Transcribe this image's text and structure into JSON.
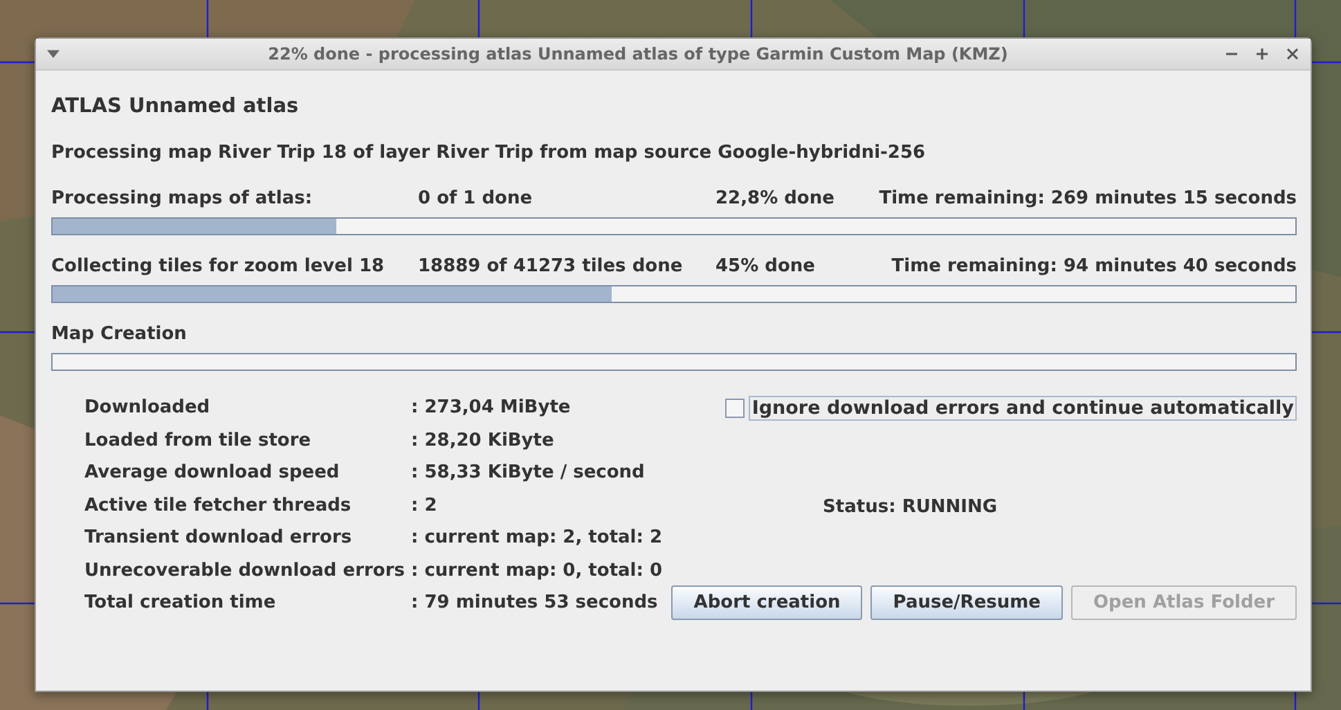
{
  "window": {
    "title": "22% done - processing atlas Unnamed atlas of type Garmin Custom Map (KMZ)"
  },
  "heading": "ATLAS Unnamed atlas",
  "subtitle": "Processing map River Trip 18 of layer River Trip from map source Google-hybridni-256",
  "progress": [
    {
      "label": "Processing maps of atlas:",
      "count": "0 of 1 done",
      "percent": "22,8% done",
      "remaining": "Time remaining: 269 minutes 15 seconds",
      "level": 0.228
    },
    {
      "label": "Collecting tiles for zoom level 18",
      "count": "18889 of 41273 tiles done",
      "percent": "45% done",
      "remaining": "Time remaining: 94 minutes 40 seconds",
      "level": 0.45
    }
  ],
  "map_creation": {
    "label": "Map Creation",
    "level": 0
  },
  "stats": [
    {
      "label": "Downloaded",
      "value": ": 273,04 MiByte"
    },
    {
      "label": "Loaded from tile store",
      "value": ": 28,20 KiByte"
    },
    {
      "label": "Average download speed",
      "value": ": 58,33 KiByte / second"
    },
    {
      "label": "Active tile fetcher threads",
      "value": ": 2"
    },
    {
      "label": "Transient download errors",
      "value": ": current map: 2, total: 2"
    },
    {
      "label": "Unrecoverable download errors",
      "value": ": current map: 0, total: 0"
    },
    {
      "label": "Total creation time",
      "value": ": 79 minutes 53 seconds"
    }
  ],
  "ignore_errors": {
    "label": "Ignore download errors and continue automatically",
    "checked": false
  },
  "status": "Status: RUNNING",
  "buttons": [
    {
      "label": "Abort creation",
      "disabled": false
    },
    {
      "label": "Pause/Resume",
      "disabled": false
    },
    {
      "label": "Open Atlas Folder",
      "disabled": true
    }
  ]
}
